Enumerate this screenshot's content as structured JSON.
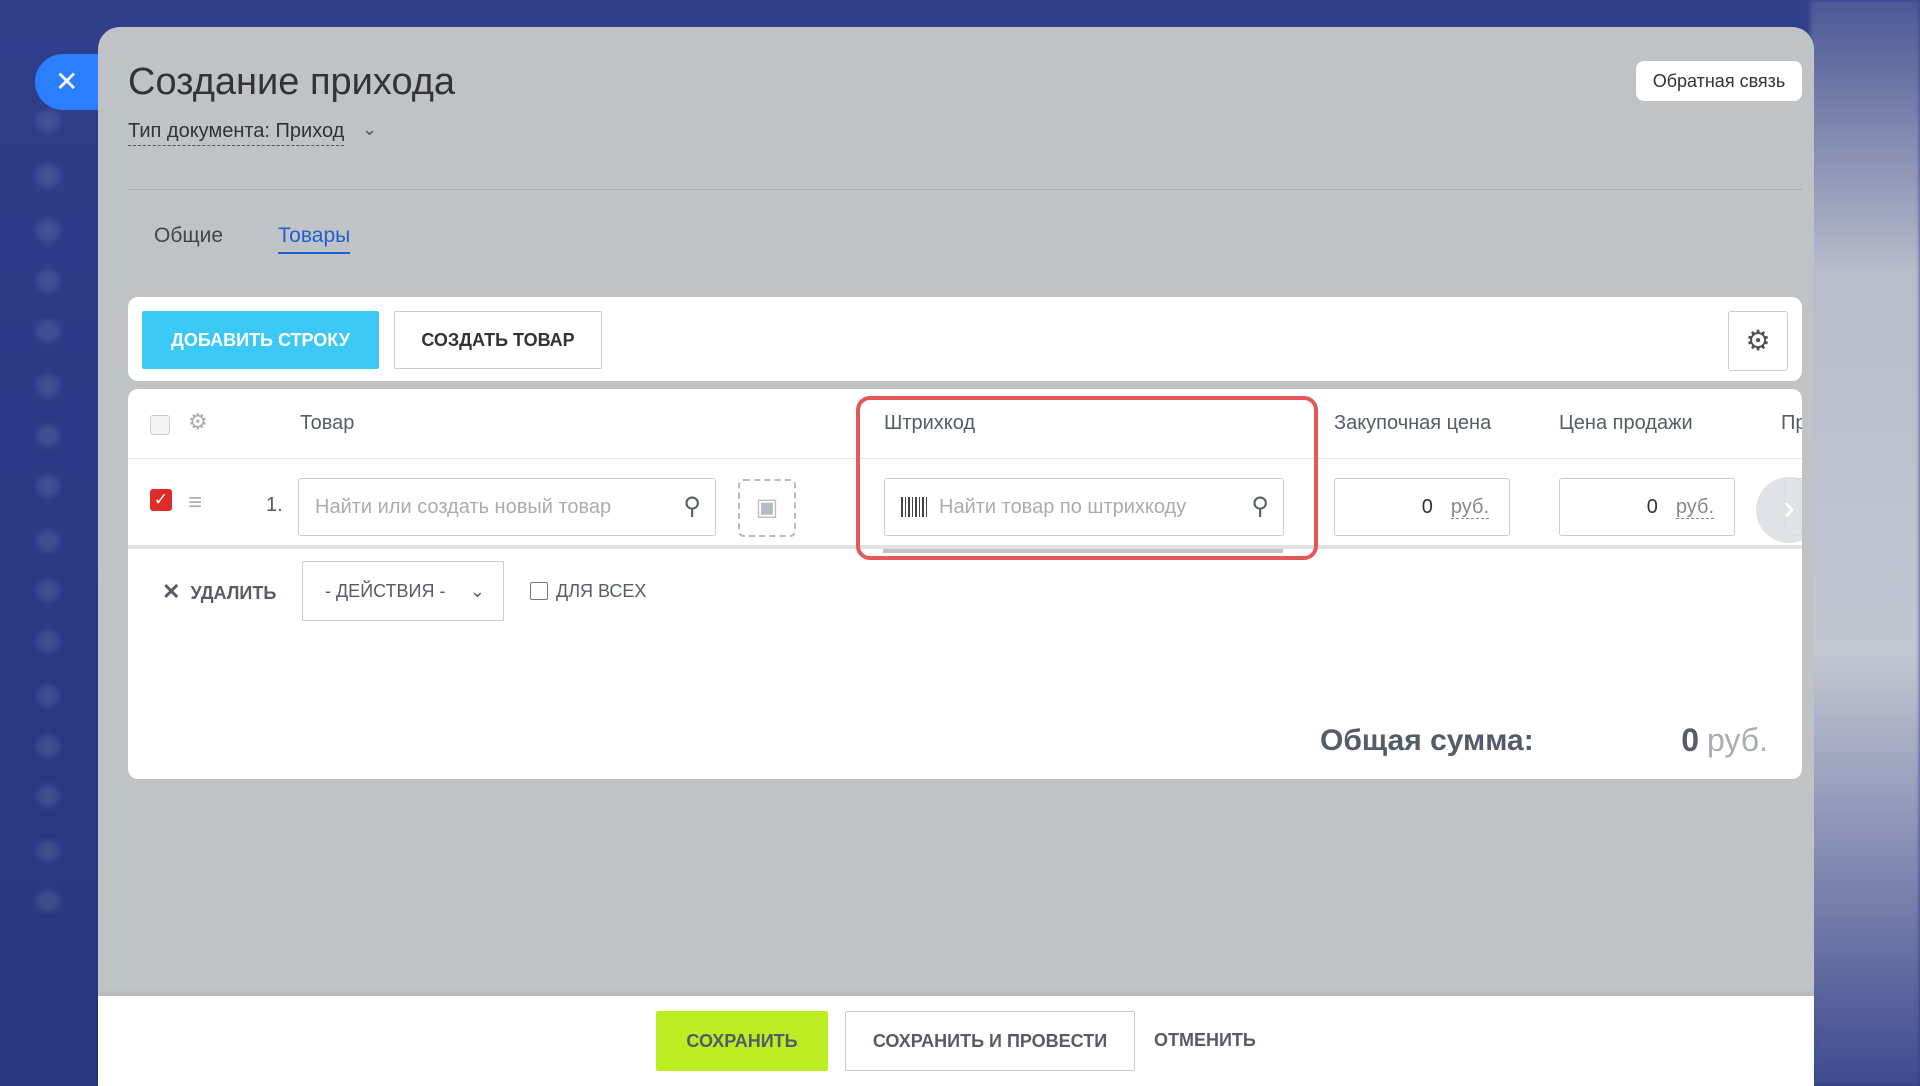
{
  "window": {
    "title": "Создание прихода",
    "doc_type_label": "Тип документа: Приход",
    "feedback_label": "Обратная связь"
  },
  "tabs": [
    {
      "label": "Общие",
      "active": false
    },
    {
      "label": "Товары",
      "active": true
    }
  ],
  "toolbar": {
    "add_row_label": "ДОБАВИТЬ СТРОКУ",
    "create_product_label": "СОЗДАТЬ ТОВАР"
  },
  "table": {
    "columns": [
      "Товар",
      "Штрихкод",
      "Закупочная цена",
      "Цена продажи",
      "Пр"
    ],
    "rows": [
      {
        "number": "1.",
        "checked": true,
        "product_placeholder": "Найти или создать новый товар",
        "barcode_placeholder": "Найти товар по штрихкоду",
        "purchase_price": "0",
        "purchase_currency": "руб.",
        "sale_price": "0",
        "sale_currency": "руб."
      }
    ]
  },
  "actions": {
    "delete_label": "УДАЛИТЬ",
    "actions_select_value": "- ДЕЙСТВИЯ -",
    "for_all_label": "ДЛЯ ВСЕХ"
  },
  "total": {
    "label": "Общая сумма:",
    "value": "0",
    "currency": "руб."
  },
  "footer": {
    "save_label": "СОХРАНИТЬ",
    "save_post_label": "СОХРАНИТЬ И ПРОВЕСТИ",
    "cancel_label": "ОТМЕНИТЬ"
  },
  "colors": {
    "accent_blue": "#3bc8f5",
    "save_green": "#bbed21",
    "highlight_red": "#e4585a",
    "tab_active": "#1f5fd1"
  }
}
